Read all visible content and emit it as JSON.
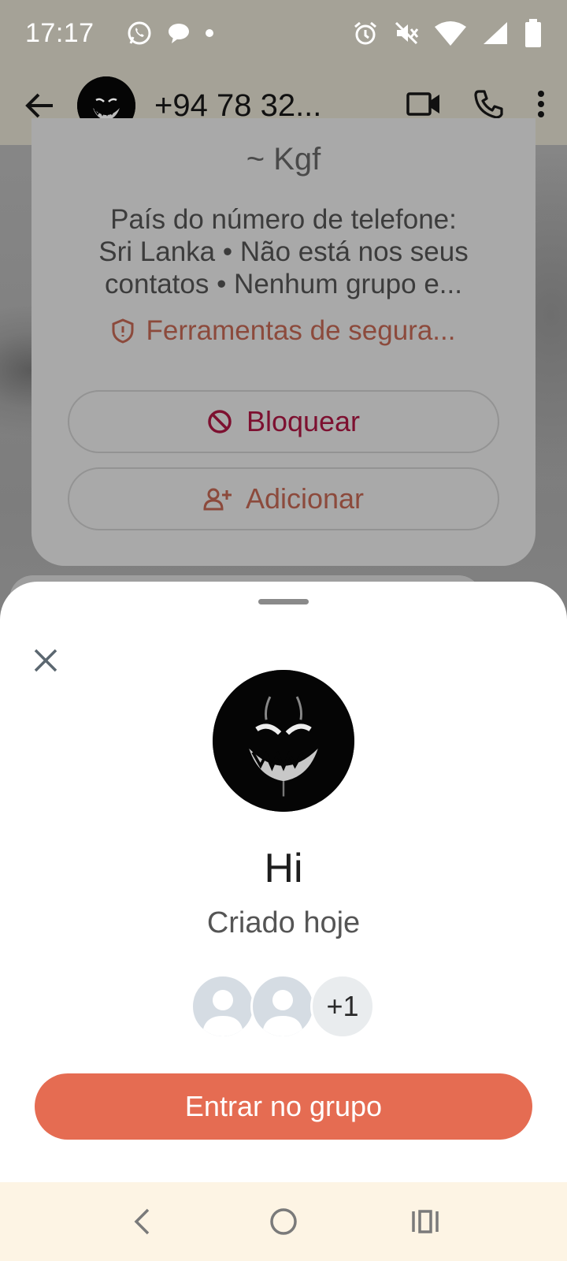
{
  "status_bar": {
    "time": "17:17",
    "left_icons": [
      "whatsapp-icon",
      "chat-bubble-icon",
      "dot-icon"
    ],
    "right_icons": [
      "alarm-icon",
      "vibrate-off-icon",
      "wifi-icon",
      "signal-icon",
      "battery-icon"
    ]
  },
  "app_bar": {
    "title": "+94 78 32...",
    "icons": [
      "back-arrow-icon",
      "video-call-icon",
      "phone-icon",
      "more-vert-icon"
    ]
  },
  "info_card": {
    "name": "~ Kgf",
    "info_lines": [
      "País do número de telefone:",
      "Sri Lanka • Não está nos seus",
      "contatos • Nenhum grupo e..."
    ],
    "security_label": "Ferramentas de segura...",
    "block_label": "Bloquear",
    "add_label": "Adicionar"
  },
  "sheet": {
    "group_name": "Hi",
    "created_label": "Criado hoje",
    "more_members": "+1",
    "join_label": "Entrar no grupo"
  },
  "colors": {
    "accent": "#e56c52",
    "block": "#7d1030",
    "status_bar": "#a5a297",
    "nav_bar": "#fdf4e4"
  }
}
